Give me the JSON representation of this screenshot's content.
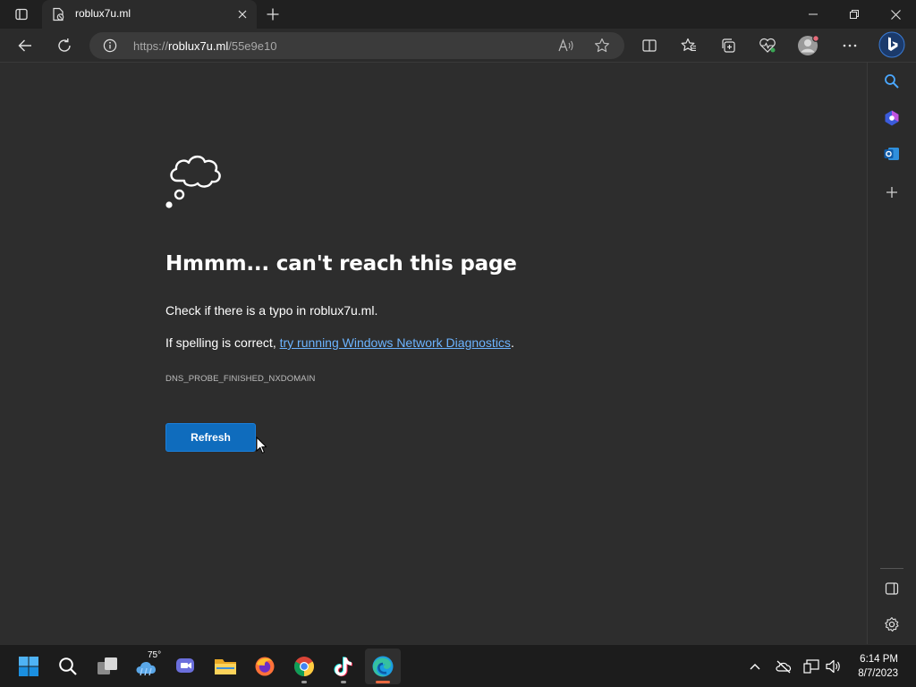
{
  "tab": {
    "title": "roblux7u.ml"
  },
  "address": {
    "url_prefix": "https://",
    "host": "roblux7u.ml",
    "path": "/55e9e10"
  },
  "error": {
    "heading": "Hmmm... can't reach this page",
    "typo_text": "Check if there is a typo in roblux7u.ml.",
    "spelling_prefix": "If spelling is correct, ",
    "diagnostics_link": "try running Windows Network Diagnostics",
    "spelling_suffix": ".",
    "code": "DNS_PROBE_FINISHED_NXDOMAIN",
    "refresh_label": "Refresh"
  },
  "taskbar": {
    "weather_temp": "75°",
    "time": "6:14 PM",
    "date": "8/7/2023"
  },
  "colors": {
    "accent": "#0f6cbd",
    "link": "#6cb4ff",
    "page_background": "#2d2d2d",
    "toolbar_background": "#2b2b2b"
  },
  "icons": {
    "tab_actions": "tab-actions-icon",
    "back": "back-arrow-icon",
    "refresh": "refresh-icon",
    "site_info": "info-icon",
    "read_aloud": "read-aloud-icon",
    "favorite": "star-icon",
    "split_screen": "split-screen-icon",
    "favorites": "favorites-icon",
    "collections": "collections-icon",
    "performance": "heartbeat-icon",
    "profile": "profile-avatar-icon",
    "more": "more-icon",
    "copilot": "bing-copilot-icon"
  }
}
